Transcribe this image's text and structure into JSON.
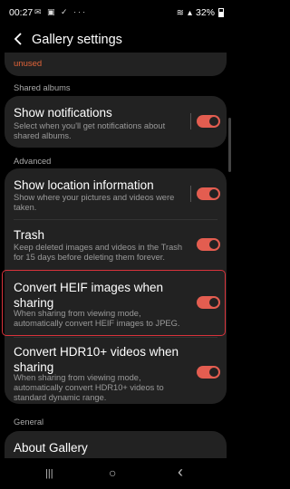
{
  "status_bar": {
    "time": "00:27",
    "notification_icons": "✉ ▣ ✓ ···",
    "battery": "32%"
  },
  "header": {
    "title": "Gallery settings"
  },
  "top_card": {
    "cut_text": "unused"
  },
  "sections": {
    "shared_albums": "Shared albums",
    "advanced": "Advanced",
    "general": "General"
  },
  "settings": {
    "show_notifications": {
      "title": "Show notifications",
      "subtitle": "Select when you'll get notifications about shared albums.",
      "enabled": true
    },
    "show_location": {
      "title": "Show location information",
      "subtitle": "Show where your pictures and videos were taken.",
      "enabled": true
    },
    "trash": {
      "title": "Trash",
      "subtitle": "Keep deleted images and videos in the Trash for 15 days before deleting them forever.",
      "enabled": true
    },
    "convert_heif": {
      "title": "Convert HEIF images when sharing",
      "subtitle": "When sharing from viewing mode, automatically convert HEIF images to JPEG.",
      "enabled": true
    },
    "convert_hdr": {
      "title": "Convert HDR10+ videos when sharing",
      "subtitle": "When sharing from viewing mode, automatically convert HDR10+ videos to standard dynamic range.",
      "enabled": true
    },
    "about": {
      "title": "About Gallery"
    }
  },
  "colors": {
    "accent": "#e35d50",
    "card": "#222222",
    "highlight": "#d9333b",
    "orange_text": "#e1643a"
  },
  "nav": {
    "recents": "|||",
    "home": "○",
    "back": "‹"
  }
}
